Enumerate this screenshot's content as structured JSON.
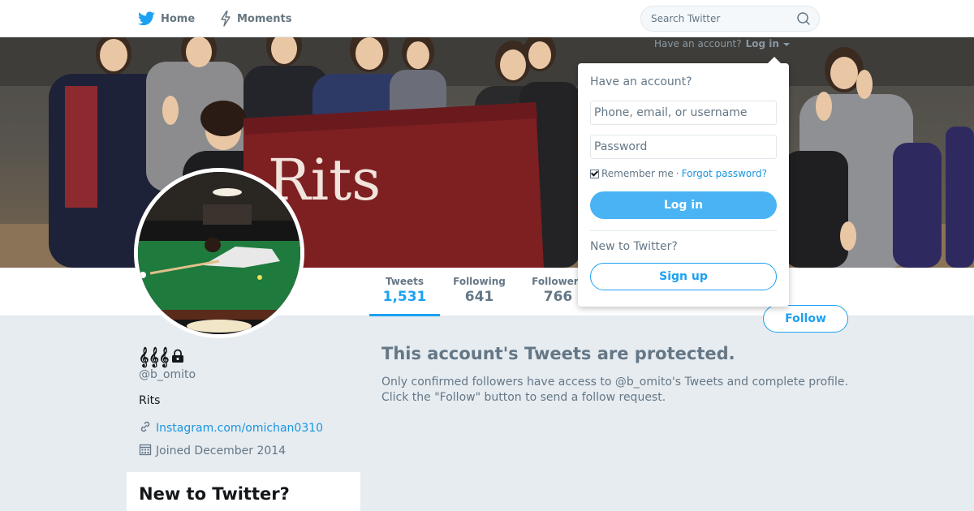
{
  "nav": {
    "home_label": "Home",
    "moments_label": "Moments",
    "search_placeholder": "Search Twitter"
  },
  "login_mini": {
    "prompt": "Have an account?",
    "link": "Log in"
  },
  "cover": {
    "banner_text": "Rits"
  },
  "profile_nav": {
    "tweets_label": "Tweets",
    "tweets_value": "1,531",
    "following_label": "Following",
    "following_value": "641",
    "followers_label": "Followers",
    "followers_value": "766"
  },
  "follow_label": "Follow",
  "profile": {
    "name": "𝄞𝄞𝄞",
    "handle": "@b_omito",
    "bio": "Rits",
    "url": "Instagram.com/omichan0310",
    "joined": "Joined December 2014"
  },
  "new_card_title": "New to Twitter?",
  "protected": {
    "title": "This account's Tweets are protected.",
    "body_line1": "Only confirmed followers have access to @b_omito's Tweets and complete profile.",
    "body_line2": "Click the \"Follow\" button to send a follow request."
  },
  "login_dropdown": {
    "title": "Have an account?",
    "username_placeholder": "Phone, email, or username",
    "password_placeholder": "Password",
    "remember": "Remember me",
    "separator": "·",
    "forgot": "Forgot password?",
    "login_label": "Log in",
    "new_prompt": "New to Twitter?",
    "signup_label": "Sign up"
  },
  "colors": {
    "accent": "#1da1f2",
    "link": "#1b95e0",
    "muted": "#657786",
    "background": "#e6ecf0"
  }
}
